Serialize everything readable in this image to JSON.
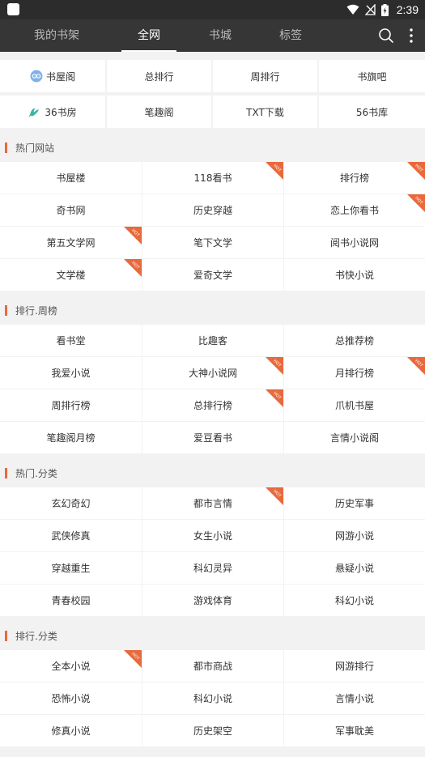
{
  "status_bar": {
    "time": "2:39"
  },
  "nav": {
    "tabs": [
      {
        "label": "我的书架",
        "active": false
      },
      {
        "label": "全网",
        "active": true
      },
      {
        "label": "书城",
        "active": false
      },
      {
        "label": "标签",
        "active": false
      }
    ]
  },
  "quick_links": [
    [
      {
        "label": "书屋阁",
        "icon": "shuwuge-logo-icon"
      },
      {
        "label": "总排行"
      },
      {
        "label": "周排行"
      },
      {
        "label": "书旗吧"
      }
    ],
    [
      {
        "label": "36书房",
        "icon": "36shufang-logo-icon"
      },
      {
        "label": "笔趣阁"
      },
      {
        "label": "TXT下载"
      },
      {
        "label": "56书库"
      }
    ]
  ],
  "badge_text": "HOT",
  "sections": [
    {
      "title": "热门网站",
      "items": [
        {
          "label": "书屋楼",
          "hot": false
        },
        {
          "label": "118看书",
          "hot": true
        },
        {
          "label": "排行榜",
          "hot": true
        },
        {
          "label": "奇书网",
          "hot": false
        },
        {
          "label": "历史穿越",
          "hot": false
        },
        {
          "label": "恋上你看书",
          "hot": true
        },
        {
          "label": "第五文学网",
          "hot": true
        },
        {
          "label": "笔下文学",
          "hot": false
        },
        {
          "label": "阅书小说网",
          "hot": false
        },
        {
          "label": "文学楼",
          "hot": true
        },
        {
          "label": "爱奇文学",
          "hot": false
        },
        {
          "label": "书快小说",
          "hot": false
        }
      ]
    },
    {
      "title": "排行.周榜",
      "items": [
        {
          "label": "看书堂",
          "hot": false
        },
        {
          "label": "比趣客",
          "hot": false
        },
        {
          "label": "总推荐榜",
          "hot": false
        },
        {
          "label": "我爱小说",
          "hot": false
        },
        {
          "label": "大神小说网",
          "hot": true
        },
        {
          "label": "月排行榜",
          "hot": true
        },
        {
          "label": "周排行榜",
          "hot": false
        },
        {
          "label": "总排行榜",
          "hot": true
        },
        {
          "label": "爪机书屋",
          "hot": false
        },
        {
          "label": "笔趣阁月榜",
          "hot": false
        },
        {
          "label": "爱豆看书",
          "hot": false
        },
        {
          "label": "言情小说阁",
          "hot": false
        }
      ]
    },
    {
      "title": "热门.分类",
      "items": [
        {
          "label": "玄幻奇幻",
          "hot": false
        },
        {
          "label": "都市言情",
          "hot": true
        },
        {
          "label": "历史军事",
          "hot": false
        },
        {
          "label": "武侠修真",
          "hot": false
        },
        {
          "label": "女生小说",
          "hot": false
        },
        {
          "label": "网游小说",
          "hot": false
        },
        {
          "label": "穿越重生",
          "hot": false
        },
        {
          "label": "科幻灵异",
          "hot": false
        },
        {
          "label": "悬疑小说",
          "hot": false
        },
        {
          "label": "青春校园",
          "hot": false
        },
        {
          "label": "游戏体育",
          "hot": false
        },
        {
          "label": "科幻小说",
          "hot": false
        }
      ]
    },
    {
      "title": "排行.分类",
      "items": [
        {
          "label": "全本小说",
          "hot": true
        },
        {
          "label": "都市商战",
          "hot": false
        },
        {
          "label": "网游排行",
          "hot": false
        },
        {
          "label": "恐怖小说",
          "hot": false
        },
        {
          "label": "科幻小说",
          "hot": false
        },
        {
          "label": "言情小说",
          "hot": false
        },
        {
          "label": "修真小说",
          "hot": false
        },
        {
          "label": "历史架空",
          "hot": false
        },
        {
          "label": "军事耽美",
          "hot": false
        }
      ]
    }
  ],
  "colors": {
    "accent": "#e8693c",
    "nav_bg": "#363636",
    "status_bg": "#2c2c2c"
  }
}
